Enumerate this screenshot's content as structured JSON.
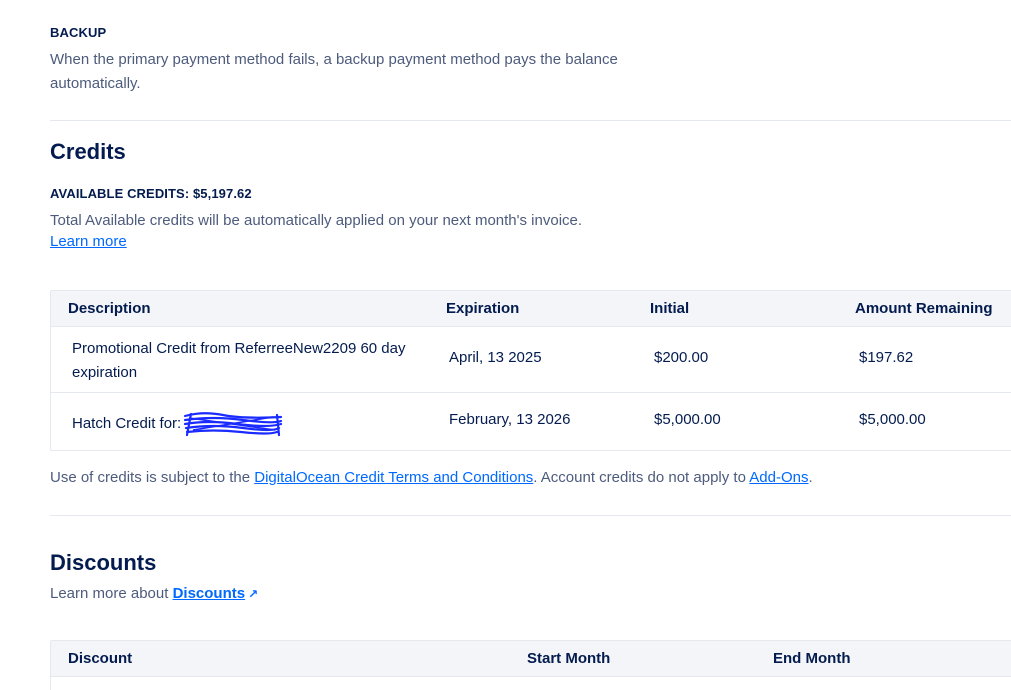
{
  "backup": {
    "title": "BACKUP",
    "description": "When the primary payment method fails, a backup payment method pays the balance automatically."
  },
  "credits": {
    "heading": "Credits",
    "available_label": "AVAILABLE CREDITS: $5,197.62",
    "description": "Total Available credits will be automatically applied on your next month's invoice.",
    "learn_more": "Learn more",
    "table": {
      "headers": [
        "Description",
        "Expiration",
        "Initial",
        "Amount Remaining"
      ],
      "rows": [
        {
          "description": "Promotional Credit from ReferreeNew2209 60 day expiration",
          "expiration": "April, 13 2025",
          "initial": "$200.00",
          "remaining": "$197.62"
        },
        {
          "description": "Hatch Credit for:",
          "expiration": "February, 13 2026",
          "initial": "$5,000.00",
          "remaining": "$5,000.00"
        }
      ]
    },
    "terms": {
      "prefix": "Use of credits is subject to the ",
      "terms_link": "DigitalOcean Credit Terms and Conditions",
      "middle": ". Account credits do not apply to ",
      "addons_link": "Add-Ons",
      "suffix": "."
    }
  },
  "discounts": {
    "heading": "Discounts",
    "learn_prefix": "Learn more about ",
    "learn_link": "Discounts",
    "table": {
      "headers": [
        "Discount",
        "Start Month",
        "End Month"
      ]
    }
  },
  "colors": {
    "text": "#031b4e",
    "muted": "#4d5b7c",
    "link": "#0069ff",
    "table_header_bg": "#f3f5f9",
    "border": "#e5e8ed",
    "redaction": "#1a2bff"
  }
}
